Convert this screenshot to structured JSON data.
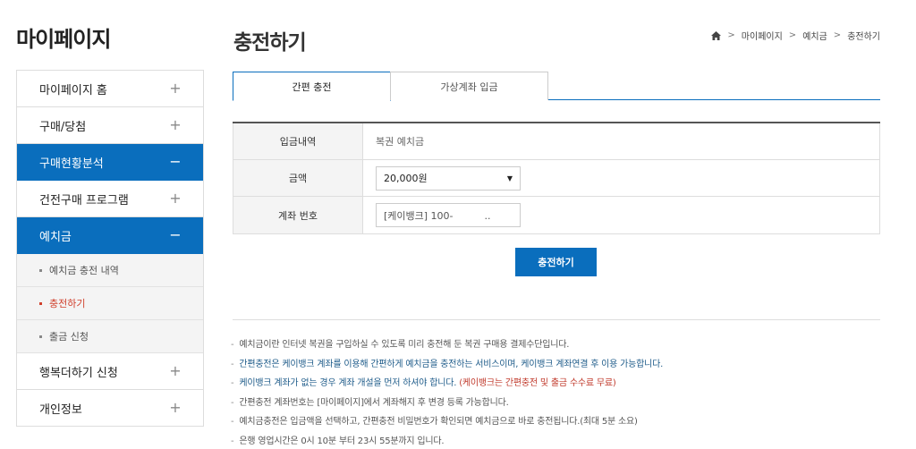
{
  "sidebar": {
    "title": "마이페이지",
    "items": [
      {
        "label": "마이페이지 홈",
        "sign": "+"
      },
      {
        "label": "구매/당첨",
        "sign": "+"
      },
      {
        "label": "구매현황분석",
        "sign": "−"
      },
      {
        "label": "건전구매 프로그램",
        "sign": "+"
      },
      {
        "label": "예치금",
        "sign": "−"
      },
      {
        "label": "행복더하기 신청",
        "sign": "+"
      },
      {
        "label": "개인정보",
        "sign": "+"
      }
    ],
    "subitems": [
      {
        "label": "예치금 충전 내역"
      },
      {
        "label": "충전하기"
      },
      {
        "label": "출금 신청"
      }
    ]
  },
  "header": {
    "title": "충전하기",
    "breadcrumb": [
      "마이페이지",
      "예치금",
      "충전하기"
    ],
    "breadcrumb_sep": ">"
  },
  "tabs": [
    {
      "label": "간편 충전"
    },
    {
      "label": "가상계좌 입금"
    }
  ],
  "form": {
    "deposit_label": "입금내역",
    "deposit_value": "복권 예치금",
    "amount_label": "금액",
    "amount_value": "20,000원",
    "account_label": "계좌 번호",
    "account_value": "[케이뱅크] 100-          .."
  },
  "charge_button": "충전하기",
  "notes": {
    "dash": "-",
    "n1": "예치금이란 인터넷 복권을 구입하실 수 있도록 미리 충전해 둔 복권 구매용 결제수단입니다.",
    "n2": "간편충전은 케이뱅크 계좌를 이용해 간편하게 예치금을 충전하는 서비스이며, 케이뱅크 계좌연결 후 이용 가능합니다.",
    "n3a": "케이뱅크 계좌가 없는 경우 계좌 개설을 먼저 하셔야 합니다. ",
    "n3b": "(케이뱅크는 간편충전 및 출금 수수료 무료)",
    "n4": "간편충전 계좌번호는 [마이페이지]에서 계좌해지 후 변경 등록 가능합니다.",
    "n5": "예치금충전은 입금액을 선택하고, 간편충전 비밀번호가 확인되면 예치금으로 바로 충전됩니다.(최대 5분 소요)",
    "n6": "은행 영업시간은 0시 10분 부터 23시 55분까지 입니다."
  },
  "colors": {
    "accent": "#0a6ebd",
    "current": "#d0402c"
  }
}
